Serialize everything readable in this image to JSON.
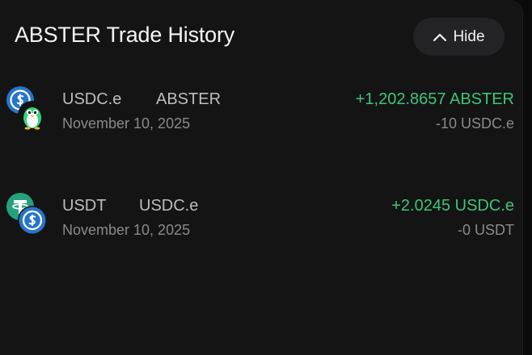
{
  "header": {
    "title": "ABSTER Trade History",
    "hide_label": "Hide"
  },
  "icons": {
    "hide": "chevron-up-icon",
    "usdc": "usdc-token-icon",
    "abster": "penguin-token-icon",
    "usdt": "tether-token-icon"
  },
  "colors": {
    "positive": "#3fc47a",
    "usdc_blue": "#2775ca",
    "usdt_green": "#26a17b"
  },
  "trades": [
    {
      "from_token": "USDC.e",
      "to_token": "ABSTER",
      "date": "November 10, 2025",
      "amount_in": "+1,202.8657 ABSTER",
      "amount_out": "-10 USDC.e"
    },
    {
      "from_token": "USDT",
      "to_token": "USDC.e",
      "date": "November 10, 2025",
      "amount_in": "+2.0245 USDC.e",
      "amount_out": "-0 USDT"
    }
  ]
}
